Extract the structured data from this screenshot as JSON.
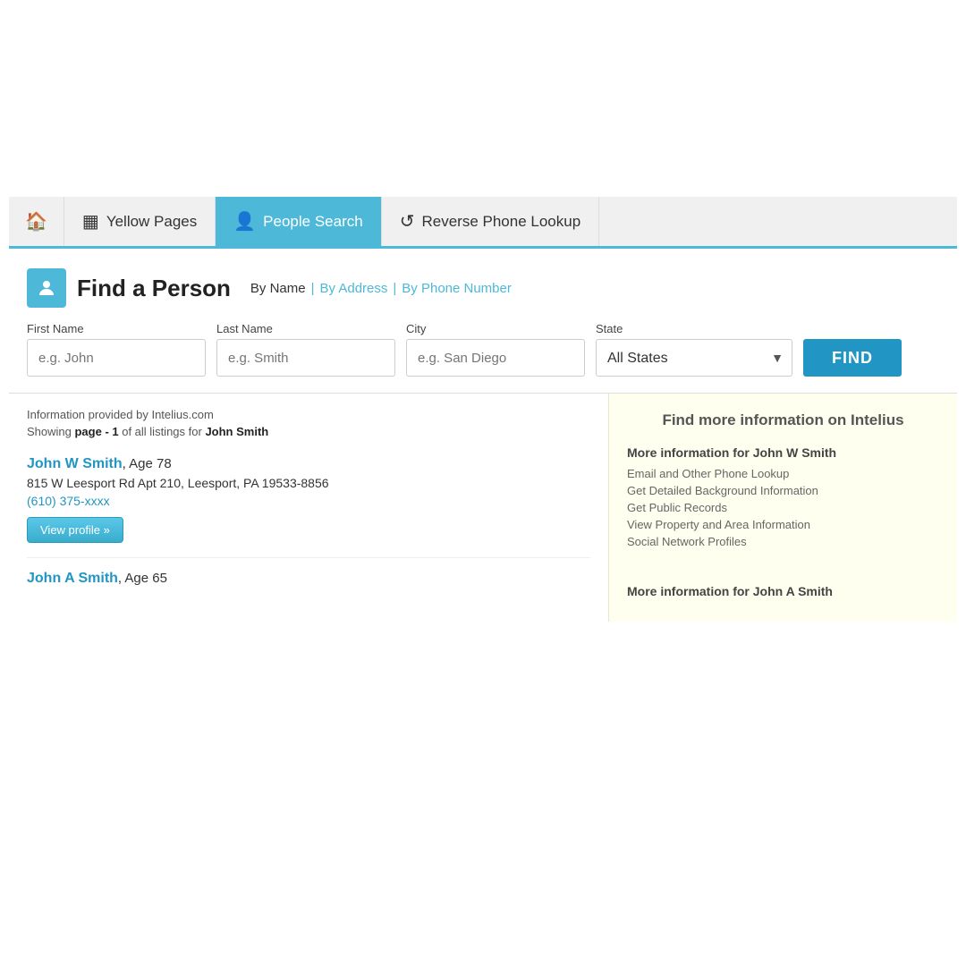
{
  "nav": {
    "home_icon": "🏠",
    "yellow_pages_icon": "▦",
    "yellow_pages_label": "Yellow Pages",
    "people_search_icon": "👤",
    "people_search_label": "People Search",
    "reverse_phone_icon": "↺",
    "reverse_phone_label": "Reverse Phone Lookup"
  },
  "search": {
    "title": "Find a Person",
    "by_name_label": "By Name",
    "by_address_label": "By Address",
    "by_phone_label": "By Phone Number",
    "first_name_label": "First Name",
    "first_name_placeholder": "e.g. John",
    "last_name_label": "Last Name",
    "last_name_placeholder": "e.g. Smith",
    "city_label": "City",
    "city_placeholder": "e.g. San Diego",
    "state_label": "State",
    "state_default": "All States",
    "find_button": "FIND"
  },
  "results": {
    "provider_info": "Information provided by Intelius.com",
    "showing_text": "Showing ",
    "page_label": "page - 1",
    "showing_text2": " of all listings for ",
    "search_name": "John Smith"
  },
  "intelius_panel": {
    "header": "Find more information on Intelius",
    "result1_more_title": "More information for John W Smith",
    "result1_links": [
      "Email and Other Phone Lookup",
      "Get Detailed Background Information",
      "Get Public Records",
      "View Property and Area Information",
      "Social Network Profiles"
    ],
    "result2_more_title": "More information for John A Smith"
  },
  "listings": [
    {
      "name": "John W Smith",
      "age_text": ", Age 78",
      "address": "815 W Leesport Rd Apt 210, Leesport, PA 19533-8856",
      "phone": "(610) 375-xxxx",
      "view_profile": "View profile »"
    },
    {
      "name": "John A Smith",
      "age_text": ", Age 65"
    }
  ]
}
